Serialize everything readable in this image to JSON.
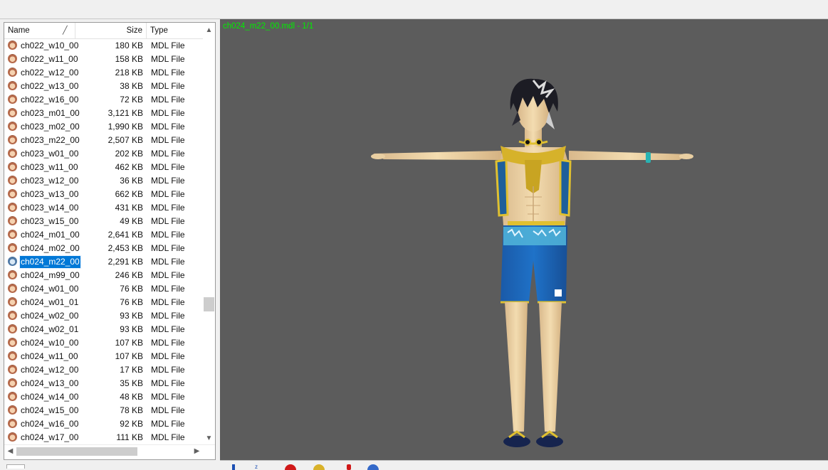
{
  "viewer": {
    "title": "ch024_m22_00.mdl - 1/1"
  },
  "filelist": {
    "columns": {
      "name": "Name",
      "size": "Size",
      "type": "Type"
    },
    "sort_glyph": "╱",
    "selected_name": "ch024_m22_00",
    "rows": [
      {
        "name": "ch022_w10_00",
        "size": "180 KB",
        "type": "MDL File"
      },
      {
        "name": "ch022_w11_00",
        "size": "158 KB",
        "type": "MDL File"
      },
      {
        "name": "ch022_w12_00",
        "size": "218 KB",
        "type": "MDL File"
      },
      {
        "name": "ch022_w13_00",
        "size": "38 KB",
        "type": "MDL File"
      },
      {
        "name": "ch022_w16_00",
        "size": "72 KB",
        "type": "MDL File"
      },
      {
        "name": "ch023_m01_00",
        "size": "3,121 KB",
        "type": "MDL File"
      },
      {
        "name": "ch023_m02_00",
        "size": "1,990 KB",
        "type": "MDL File"
      },
      {
        "name": "ch023_m22_00",
        "size": "2,507 KB",
        "type": "MDL File"
      },
      {
        "name": "ch023_w01_00",
        "size": "202 KB",
        "type": "MDL File"
      },
      {
        "name": "ch023_w11_00",
        "size": "462 KB",
        "type": "MDL File"
      },
      {
        "name": "ch023_w12_00",
        "size": "36 KB",
        "type": "MDL File"
      },
      {
        "name": "ch023_w13_00",
        "size": "662 KB",
        "type": "MDL File"
      },
      {
        "name": "ch023_w14_00",
        "size": "431 KB",
        "type": "MDL File"
      },
      {
        "name": "ch023_w15_00",
        "size": "49 KB",
        "type": "MDL File"
      },
      {
        "name": "ch024_m01_00",
        "size": "2,641 KB",
        "type": "MDL File"
      },
      {
        "name": "ch024_m02_00",
        "size": "2,453 KB",
        "type": "MDL File"
      },
      {
        "name": "ch024_m22_00",
        "size": "2,291 KB",
        "type": "MDL File"
      },
      {
        "name": "ch024_m99_00",
        "size": "246 KB",
        "type": "MDL File"
      },
      {
        "name": "ch024_w01_00",
        "size": "76 KB",
        "type": "MDL File"
      },
      {
        "name": "ch024_w01_01",
        "size": "76 KB",
        "type": "MDL File"
      },
      {
        "name": "ch024_w02_00",
        "size": "93 KB",
        "type": "MDL File"
      },
      {
        "name": "ch024_w02_01",
        "size": "93 KB",
        "type": "MDL File"
      },
      {
        "name": "ch024_w10_00",
        "size": "107 KB",
        "type": "MDL File"
      },
      {
        "name": "ch024_w11_00",
        "size": "107 KB",
        "type": "MDL File"
      },
      {
        "name": "ch024_w12_00",
        "size": "17 KB",
        "type": "MDL File"
      },
      {
        "name": "ch024_w13_00",
        "size": "35 KB",
        "type": "MDL File"
      },
      {
        "name": "ch024_w14_00",
        "size": "48 KB",
        "type": "MDL File"
      },
      {
        "name": "ch024_w15_00",
        "size": "78 KB",
        "type": "MDL File"
      },
      {
        "name": "ch024_w16_00",
        "size": "92 KB",
        "type": "MDL File"
      },
      {
        "name": "ch024_w17_00",
        "size": "111 KB",
        "type": "MDL File"
      }
    ]
  },
  "icons": {
    "file": "mdl-file-icon",
    "scroll_up": "▲",
    "scroll_down": "▼",
    "scroll_left": "◀",
    "scroll_right": "▶"
  },
  "colors": {
    "viewport_bg": "#5c5c5c",
    "title_text": "#00ee00",
    "selection": "#0078d7"
  }
}
